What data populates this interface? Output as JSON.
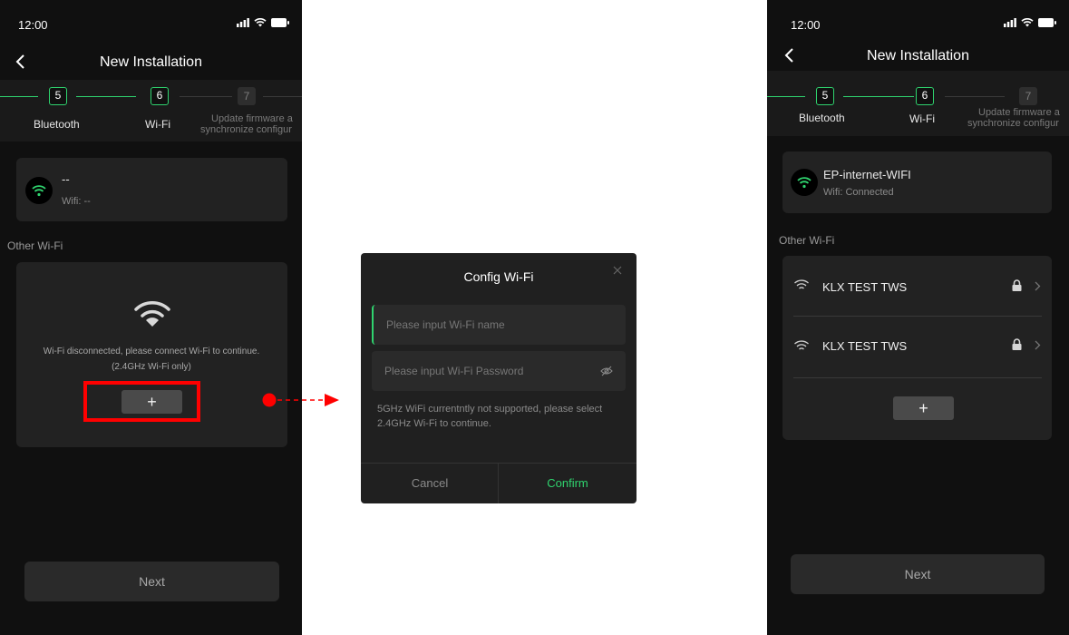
{
  "left_screen": {
    "status_time": "12:00",
    "title": "New Installation",
    "steps": [
      {
        "number": "5",
        "label": "Bluetooth"
      },
      {
        "number": "6",
        "label": "Wi-Fi"
      },
      {
        "number": "7",
        "label_line1": "Update firmware a",
        "label_line2": "synchronize configur"
      }
    ],
    "current_network": {
      "name": "--",
      "status": "Wifi: --"
    },
    "other_wifi_label": "Other Wi-Fi",
    "disconnected_line1": "Wi-Fi disconnected, please connect Wi-Fi to continue.",
    "disconnected_line2": "(2.4GHz Wi-Fi only)",
    "add_button_label": "+",
    "next_button_label": "Next"
  },
  "dialog": {
    "title": "Config Wi-Fi",
    "name_placeholder": "Please input Wi-Fi name",
    "password_placeholder": "Please input Wi-Fi Password",
    "hint": "5GHz WiFi currentntly not supported, please select 2.4GHz Wi-Fi to continue.",
    "cancel_label": "Cancel",
    "confirm_label": "Confirm"
  },
  "right_screen": {
    "status_time": "12:00",
    "title": "New Installation",
    "steps": [
      {
        "number": "5",
        "label": "Bluetooth"
      },
      {
        "number": "6",
        "label": "Wi-Fi"
      },
      {
        "number": "7",
        "label_line1": "Update firmware a",
        "label_line2": "synchronize configur"
      }
    ],
    "current_network": {
      "name": "EP-internet-WIFI",
      "status": "Wifi: Connected"
    },
    "other_wifi_label": "Other Wi-Fi",
    "networks": [
      {
        "name": "KLX TEST TWS",
        "icon": "lock-icon"
      },
      {
        "name": "KLX TEST TWS",
        "icon": "lock-icon"
      }
    ],
    "add_button_label": "+",
    "next_button_label": "Next"
  },
  "colors": {
    "accent_green": "#2fd36e",
    "highlight_red": "#ff0000",
    "background_dark": "#101010",
    "card": "#222222"
  }
}
